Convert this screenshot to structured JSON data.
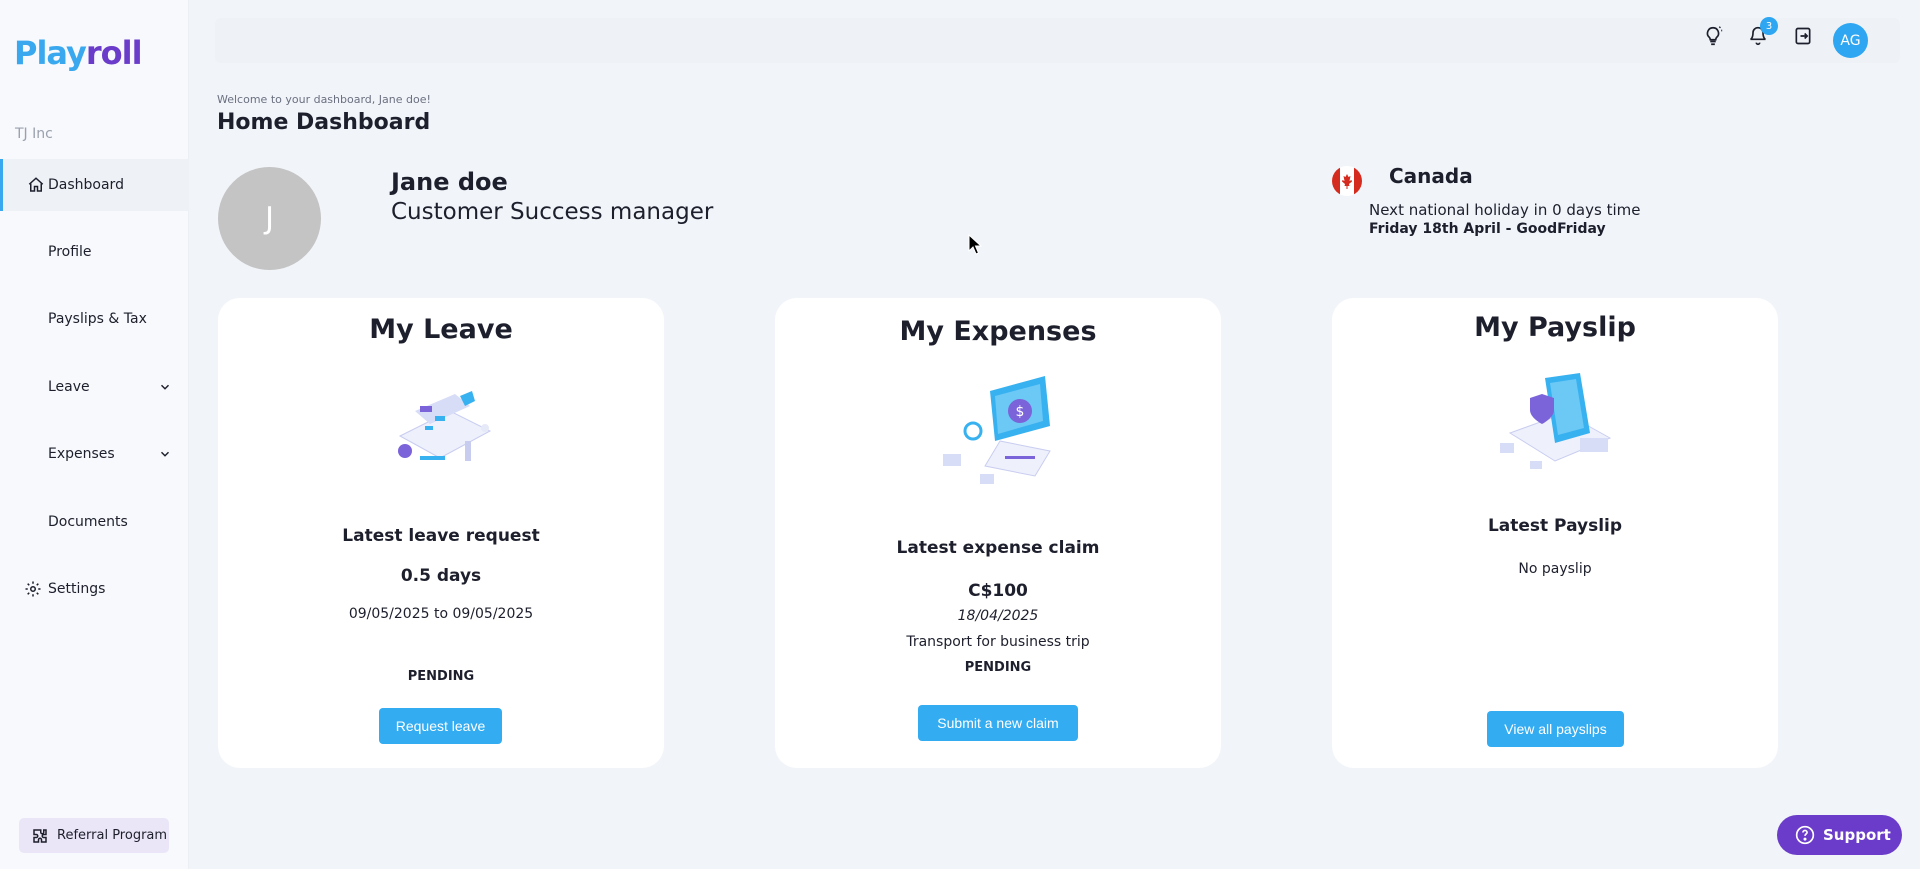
{
  "app": {
    "logo_part1": "Play",
    "logo_part2": "roll",
    "company": "TJ Inc"
  },
  "sidebar": {
    "items": [
      {
        "label": "Dashboard",
        "icon": "home-icon",
        "active": true
      },
      {
        "label": "Profile"
      },
      {
        "label": "Payslips & Tax"
      },
      {
        "label": "Leave",
        "expandable": true
      },
      {
        "label": "Expenses",
        "expandable": true
      },
      {
        "label": "Documents"
      },
      {
        "label": "Settings",
        "icon": "gear-icon"
      }
    ],
    "referral_label": "Referral Program"
  },
  "topbar": {
    "notification_count": "3",
    "user_initials": "AG"
  },
  "header": {
    "welcome": "Welcome to your dashboard, Jane doe!",
    "title": "Home Dashboard"
  },
  "profile": {
    "initial": "J",
    "name": "Jane doe",
    "role": "Customer Success manager"
  },
  "holiday": {
    "country": "Canada",
    "next": "Next national holiday in 0 days time",
    "date": "Friday 18th April - GoodFriday"
  },
  "cards": {
    "leave": {
      "title": "My Leave",
      "subtitle": "Latest leave request",
      "amount": "0.5 days",
      "range": "09/05/2025 to 09/05/2025",
      "status": "PENDING",
      "button": "Request leave"
    },
    "expenses": {
      "title": "My Expenses",
      "subtitle": "Latest expense claim",
      "amount": "C$100",
      "date": "18/04/2025",
      "description": "Transport for business trip",
      "status": "PENDING",
      "button": "Submit a new claim"
    },
    "payslip": {
      "title": "My Payslip",
      "subtitle": "Latest Payslip",
      "text": "No payslip",
      "button": "View all payslips"
    }
  },
  "support_label": "Support",
  "colors": {
    "accent": "#33acf2",
    "brand_purple": "#6b3cc9",
    "background": "#f1f4f9"
  }
}
